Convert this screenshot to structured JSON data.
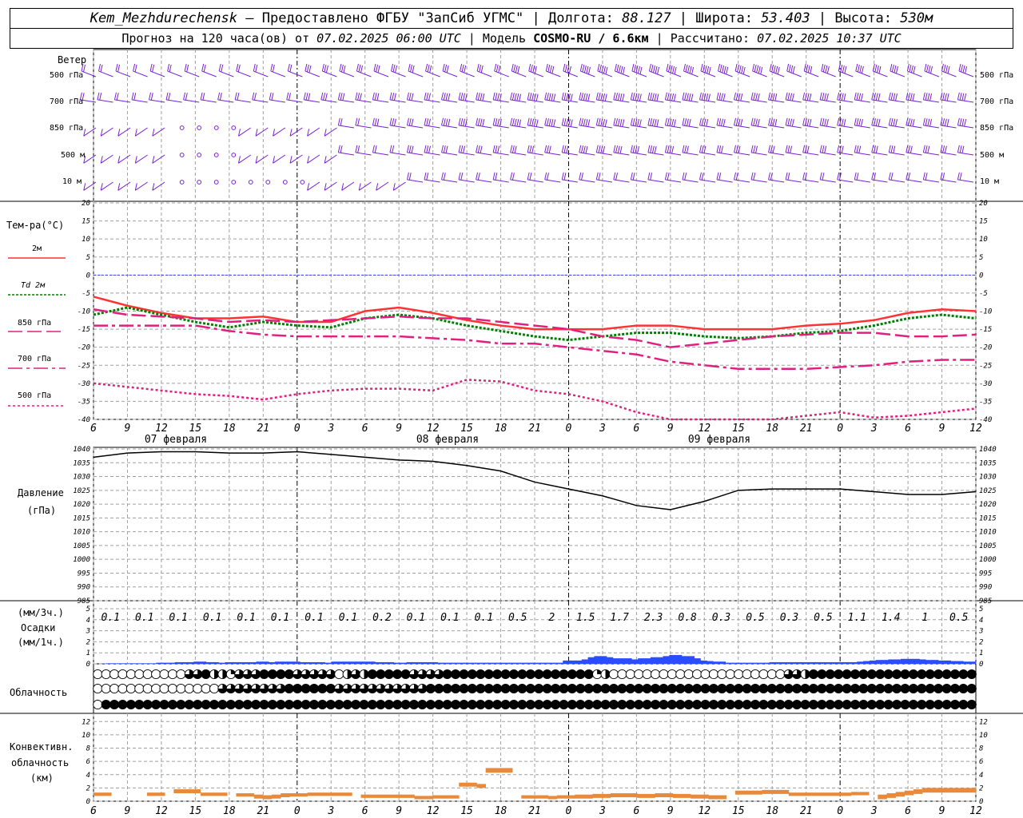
{
  "header": {
    "station": "Kem_Mezhdurechensk",
    "provided_by": "— Предоставлено ФГБУ \"ЗапСиб УГМС\"",
    "lon_label": "Долгота:",
    "lon": "88.127",
    "lat_label": "Широта:",
    "lat": "53.403",
    "alt_label": "Высота:",
    "alt": "530м",
    "forecast_prefix": "Прогноз на 120 часа(ов) от",
    "forecast_start": "07.02.2025 06:00 UTC",
    "model_label": "Модель",
    "model": "COSMO-RU / 6.6км",
    "calc_label": "Рассчитано:",
    "calc_time": "07.02.2025 10:37 UTC"
  },
  "labels": {
    "wind": "Ветер",
    "wind_levels": [
      "500 гПа",
      "700 гПа",
      "850 гПа",
      "500 м",
      "10  м"
    ],
    "temp_title": "Тем-ра(°C)",
    "temp_legend": [
      "2м",
      "Td  2м",
      "850 гПа",
      "700 гПа",
      "500 гПа"
    ],
    "pressure_title": "Давление",
    "pressure_unit": "(гПа)",
    "precip_unit_3h": "(мм/3ч.)",
    "precip_title": "Осадки",
    "precip_unit_1h": "(мм/1ч.)",
    "cloud_title": "Облачность",
    "conv_title": "Конвективн.",
    "conv_title2": "облачность",
    "conv_unit": "(км)"
  },
  "chart_data": [
    {
      "type": "line",
      "title": "Тем-ра(°C)",
      "x": [
        "07 02 06",
        "07 02 09",
        "07 02 12",
        "07 02 15",
        "07 02 18",
        "07 02 21",
        "08 02 00",
        "08 02 03",
        "08 02 06",
        "08 02 09",
        "08 02 12",
        "08 02 15",
        "08 02 18",
        "08 02 21",
        "09 02 00",
        "09 02 03",
        "09 02 06",
        "09 02 09",
        "09 02 12",
        "09 02 15",
        "09 02 18",
        "09 02 21",
        "10 02 00",
        "10 02 03",
        "10 02 06",
        "10 02 09",
        "10 02 12"
      ],
      "x_tick_labels": [
        "6",
        "9",
        "12",
        "15",
        "18",
        "21",
        "0",
        "3",
        "6",
        "9",
        "12",
        "15",
        "18",
        "21",
        "0",
        "3",
        "6",
        "9",
        "12",
        "15",
        "18",
        "21",
        "0",
        "3",
        "6",
        "9",
        "12"
      ],
      "day_labels": [
        "07 февраля",
        "08 февраля",
        "09 февраля"
      ],
      "ylim": [
        -40,
        20
      ],
      "yticks": [
        20,
        15,
        10,
        5,
        0,
        -5,
        -10,
        -15,
        -20,
        -25,
        -30,
        -35,
        -40
      ],
      "series": [
        {
          "name": "2м",
          "color": "#ff3333",
          "values": [
            -6,
            -8.5,
            -10.5,
            -12,
            -12,
            -11.5,
            -13,
            -13,
            -10,
            -9,
            -10.5,
            -12.5,
            -14,
            -15,
            -15,
            -15,
            -14,
            -14,
            -15,
            -15,
            -15,
            -14,
            -13.5,
            -12.5,
            -10.5,
            -9.5,
            -10
          ]
        },
        {
          "name": "Td  2м",
          "color": "#008000",
          "values": [
            -11,
            -9,
            -11,
            -13,
            -14.5,
            -13,
            -14,
            -14.5,
            -12,
            -11,
            -12,
            -14,
            -15.5,
            -17,
            -18,
            -17,
            -16,
            -16,
            -17,
            -17.5,
            -17,
            -16,
            -15.5,
            -14,
            -12,
            -11,
            -12
          ]
        },
        {
          "name": "850 гПа",
          "color": "#e0207f",
          "values": [
            -9.5,
            -11,
            -11.5,
            -12,
            -13,
            -12.5,
            -13,
            -12.5,
            -12,
            -11.5,
            -12,
            -12,
            -13,
            -14,
            -15,
            -17,
            -18,
            -20,
            -19,
            -18,
            -17,
            -16.5,
            -16,
            -16,
            -17,
            -17,
            -16.5
          ]
        },
        {
          "name": "700 гПа",
          "color": "#e0207f",
          "values": [
            -14,
            -14,
            -14,
            -14,
            -15.5,
            -16.5,
            -17,
            -17,
            -17,
            -17,
            -17.5,
            -18,
            -19,
            -19,
            -20,
            -21,
            -22,
            -24,
            -25,
            -26,
            -26,
            -26,
            -25.5,
            -25,
            -24,
            -23.5,
            -23.5
          ]
        },
        {
          "name": "500 гПа",
          "color": "#e0207f",
          "values": [
            -30,
            -31,
            -32,
            -33,
            -33.5,
            -34.5,
            -33,
            -32,
            -31.5,
            -31.5,
            -32,
            -29,
            -29.5,
            -32,
            -33,
            -35,
            -38,
            -40,
            -40.5,
            -41,
            -40,
            -39,
            -38,
            -39.5,
            -39,
            -38,
            -37
          ]
        }
      ]
    },
    {
      "type": "line",
      "title": "Давление",
      "ylabel": "(гПа)",
      "ylim": [
        985,
        1040
      ],
      "yticks": [
        1040,
        1035,
        1030,
        1025,
        1020,
        1015,
        1010,
        1005,
        1000,
        995,
        990,
        985
      ],
      "series": [
        {
          "name": "Давление",
          "color": "#000000",
          "values": [
            1037,
            1038.5,
            1039,
            1039,
            1038.5,
            1038.5,
            1039,
            1038,
            1037,
            1036,
            1035.5,
            1034,
            1032,
            1028,
            1025.5,
            1023,
            1019.5,
            1018,
            1021,
            1025,
            1025.5,
            1025.5,
            1025.5,
            1024.5,
            1023.5,
            1023.5,
            1024.5
          ]
        }
      ]
    },
    {
      "type": "bar",
      "title": "Осадки",
      "ylim": [
        0,
        5
      ],
      "yticks": [
        5,
        4,
        3,
        2,
        1,
        0
      ],
      "labels_3h": [
        "0.1",
        "0.1",
        "0.1",
        "0.1",
        "0.1",
        "0.1",
        "0.1",
        "0.1",
        "0.2",
        "0.1",
        "0.1",
        "0.1",
        "0.5",
        "2",
        "1.5",
        "1.7",
        "2.3",
        "0.8",
        "0.3",
        "0.5",
        "0.3",
        "0.5",
        "1.1",
        "1.4",
        "1",
        "0.5"
      ],
      "series": [
        {
          "name": "мм/1ч.",
          "color": "#2a4dff",
          "values": [
            0,
            0.02,
            0.05,
            0.05,
            0.05,
            0.05,
            0.05,
            0.05,
            0.05,
            0.05,
            0.1,
            0.1,
            0.1,
            0.15,
            0.15,
            0.15,
            0.2,
            0.2,
            0.15,
            0.15,
            0.1,
            0.15,
            0.15,
            0.15,
            0.15,
            0.15,
            0.2,
            0.2,
            0.15,
            0.2,
            0.2,
            0.2,
            0.2,
            0.15,
            0.15,
            0.15,
            0.15,
            0.1,
            0.2,
            0.2,
            0.2,
            0.2,
            0.2,
            0.2,
            0.2,
            0.15,
            0.15,
            0.15,
            0.1,
            0.1,
            0.15,
            0.15,
            0.15,
            0.15,
            0.15,
            0.1,
            0.1,
            0.1,
            0.1,
            0.1,
            0.1,
            0.1,
            0.1,
            0.1,
            0.1,
            0.1,
            0.1,
            0.1,
            0.1,
            0.1,
            0.1,
            0.1,
            0.1,
            0.1,
            0.1,
            0.3,
            0.3,
            0.3,
            0.4,
            0.6,
            0.7,
            0.7,
            0.6,
            0.5,
            0.5,
            0.5,
            0.4,
            0.5,
            0.5,
            0.6,
            0.6,
            0.7,
            0.8,
            0.8,
            0.7,
            0.7,
            0.5,
            0.3,
            0.25,
            0.2,
            0.2,
            0.1,
            0.1,
            0.1,
            0.1,
            0.1,
            0.1,
            0.1,
            0.15,
            0.15,
            0.15,
            0.15,
            0.15,
            0.15,
            0.15,
            0.15,
            0.15,
            0.15,
            0.15,
            0.15,
            0.15,
            0.15,
            0.2,
            0.25,
            0.3,
            0.35,
            0.35,
            0.4,
            0.4,
            0.45,
            0.45,
            0.45,
            0.4,
            0.35,
            0.35,
            0.3,
            0.3,
            0.25,
            0.25,
            0.2,
            0.2
          ]
        }
      ]
    },
    {
      "type": "bar",
      "title": "Конвективн. облачность",
      "ylabel": "(км)",
      "ylim": [
        0,
        13
      ],
      "yticks": [
        12,
        10,
        8,
        6,
        4,
        2,
        0
      ],
      "series": [
        {
          "name": "base",
          "color": "#e88a3a",
          "values": [
            0.8,
            0.8,
            0,
            0,
            0,
            0,
            0.8,
            0.8,
            0,
            1.2,
            1.2,
            1.2,
            0.8,
            0.8,
            0.8,
            0,
            0.7,
            0.7,
            0.4,
            0.3,
            0.4,
            0.6,
            0.7,
            0.7,
            0.8,
            0.8,
            0.8,
            0.8,
            0.8,
            0,
            0.5,
            0.5,
            0.5,
            0.5,
            0.5,
            0.5,
            0.3,
            0.3,
            0.4,
            0.4,
            0.4,
            2.2,
            2.2,
            2.0,
            4.3,
            4.3,
            4.3,
            0,
            0.4,
            0.4,
            0.4,
            0.3,
            0.4,
            0.4,
            0.4,
            0.4,
            0.5,
            0.5,
            0.6,
            0.6,
            0.6,
            0.5,
            0.5,
            0.6,
            0.6,
            0.5,
            0.5,
            0.4,
            0.4,
            0.3,
            0.3,
            0,
            1.0,
            1.0,
            1.0,
            1.1,
            1.1,
            1.1,
            0.8,
            0.8,
            0.8,
            0.8,
            0.8,
            0.8,
            0.8,
            0.9,
            0.9,
            0,
            0.3,
            0.5,
            0.7,
            0.9,
            1.1,
            1.3,
            1.3,
            1.3,
            1.3,
            1.3,
            1.3
          ]
        },
        {
          "name": "top",
          "color": "#e88a3a",
          "values": [
            1.3,
            1.3,
            0,
            0,
            0,
            0,
            1.3,
            1.3,
            0,
            1.8,
            1.8,
            1.8,
            1.3,
            1.3,
            1.3,
            0,
            1.2,
            1.2,
            1.0,
            0.9,
            1.0,
            1.2,
            1.2,
            1.2,
            1.3,
            1.3,
            1.3,
            1.3,
            1.3,
            0,
            1.0,
            1.0,
            1.0,
            1.0,
            1.0,
            1.0,
            0.8,
            0.8,
            0.9,
            0.9,
            0.9,
            2.8,
            2.8,
            2.6,
            5.0,
            5.0,
            5.0,
            0,
            0.9,
            0.9,
            0.9,
            0.8,
            0.9,
            0.9,
            1.0,
            1.0,
            1.1,
            1.1,
            1.2,
            1.2,
            1.2,
            1.1,
            1.1,
            1.2,
            1.2,
            1.1,
            1.1,
            1.0,
            1.0,
            0.9,
            0.9,
            0,
            1.6,
            1.6,
            1.6,
            1.7,
            1.7,
            1.7,
            1.3,
            1.3,
            1.3,
            1.3,
            1.3,
            1.3,
            1.3,
            1.4,
            1.4,
            0,
            1.0,
            1.2,
            1.4,
            1.6,
            1.8,
            2.0,
            2.0,
            2.0,
            2.0,
            2.0,
            2.0
          ]
        }
      ]
    }
  ],
  "clouds": {
    "rows": [
      "0000000000033422133344443333302324444433334444444444444444441200000000000000000000033244444444444444444444",
      "0000000000000003333333344444433333333333444444444444444444444444444444444444444444444444444444444444444444",
      "0444444444444444444444444444444444444444444444444444444444444444444444444444444444444444444444444444444444"
    ]
  },
  "wind": {
    "levels": [
      {
        "dir": "sw",
        "strength": [
          2,
          2,
          2,
          2,
          2,
          2,
          2,
          3,
          3,
          3,
          3,
          3,
          3,
          4,
          4,
          5,
          5,
          5,
          5,
          5,
          5,
          4,
          4,
          4,
          4,
          4,
          4
        ]
      },
      {
        "dir": "w",
        "strength": [
          2,
          2,
          2,
          2,
          2,
          2,
          2,
          3,
          3,
          3,
          3,
          4,
          4,
          5,
          5,
          5,
          5,
          5,
          5,
          4,
          4,
          4,
          4,
          4,
          4,
          4,
          4
        ]
      },
      {
        "dir": "w",
        "strength": [
          1,
          1,
          1,
          0,
          0,
          1,
          1,
          1,
          2,
          3,
          3,
          4,
          4,
          5,
          5,
          5,
          5,
          5,
          4,
          4,
          4,
          4,
          4,
          4,
          4,
          4,
          4
        ]
      },
      {
        "dir": "w",
        "strength": [
          1,
          1,
          1,
          0,
          0,
          1,
          1,
          1,
          2,
          2,
          3,
          3,
          3,
          3,
          3,
          4,
          4,
          4,
          3,
          3,
          3,
          3,
          3,
          3,
          3,
          3,
          3
        ]
      },
      {
        "dir": "w",
        "strength": [
          1,
          1,
          1,
          0,
          0,
          0,
          0,
          1,
          1,
          1,
          2,
          2,
          2,
          2,
          2,
          2,
          2,
          2,
          2,
          2,
          2,
          2,
          2,
          2,
          2,
          2,
          2
        ]
      }
    ]
  },
  "colors": {
    "grid": "#a0a0a0",
    "wind": "#7a1fd6",
    "temp2m": "#ff3333",
    "td": "#008000",
    "levels": "#e0207f",
    "zero_line": "#3344ff",
    "precip": "#2a4dff",
    "conv": "#e88a3a"
  }
}
